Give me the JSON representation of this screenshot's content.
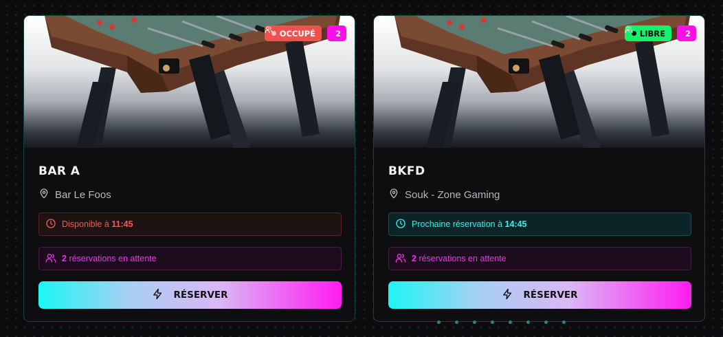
{
  "cards": [
    {
      "title": "BAR A",
      "location": "Bar Le Foos",
      "status": {
        "label": "OCCUPÉ",
        "state": "occupied",
        "color": "#f0504e"
      },
      "player_count": "2",
      "availability": {
        "prefix": "Disponible à",
        "time": "11:45"
      },
      "queue": {
        "count": "2",
        "text": "réservations en attente"
      },
      "reserve_label": "RÉSERVER"
    },
    {
      "title": "BKFD",
      "location": "Souk - Zone Gaming",
      "status": {
        "label": "LIBRE",
        "state": "free",
        "color": "#12f26a"
      },
      "player_count": "2",
      "availability": {
        "prefix": "Prochaine réservation à",
        "time": "14:45"
      },
      "queue": {
        "count": "2",
        "text": "réservations en attente"
      },
      "reserve_label": "RÉSERVER"
    }
  ],
  "icons": {
    "location": "map-pin-icon",
    "clock": "clock-icon",
    "users": "users-icon",
    "reserve": "lightning-icon"
  },
  "pagination": {
    "pages": 8
  },
  "colors": {
    "accent_cyan": "#1cf6f4",
    "accent_pink": "#ff1cf1",
    "occupied_red": "#f0504e",
    "free_green": "#12f26a"
  }
}
